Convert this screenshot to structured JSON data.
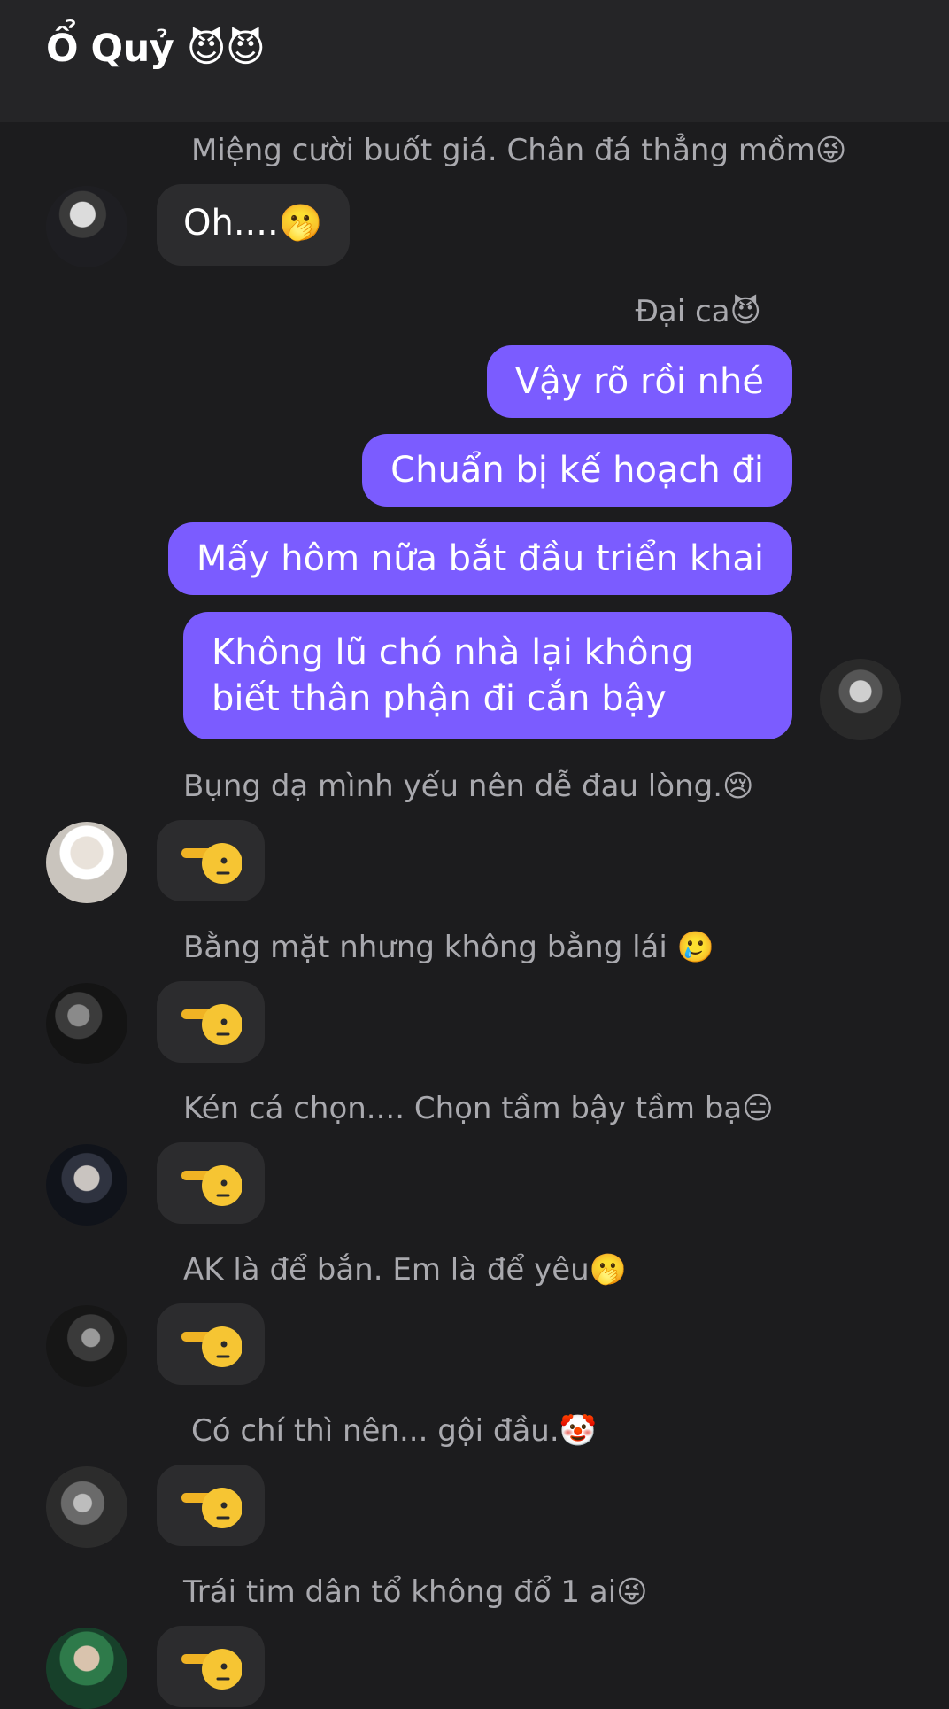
{
  "header": {
    "title": "Ổ Quỷ",
    "title_emoji": "😈😈"
  },
  "messages": [
    {
      "sender": "Miệng cười buốt giá. Chân đá thẳng mồm",
      "sender_emoji": "😜",
      "text": "Oh....",
      "text_emoji": "🫢"
    },
    {
      "sender": "Đại ca",
      "sender_emoji": "😈",
      "outgoing": [
        "Vậy rõ rồi nhé",
        "Chuẩn bị kế hoạch đi",
        "Mấy hôm nữa bắt đầu triển khai",
        "Không lũ chó nhà lại không biết thân phận đi cắn bậy"
      ]
    },
    {
      "sender": "Bụng dạ mình yếu nên dễ đau lòng.",
      "sender_emoji": "😢",
      "sticker": "🫡"
    },
    {
      "sender": "Bằng mặt nhưng không bằng lái ",
      "sender_emoji": "🥲",
      "sticker": "🫡"
    },
    {
      "sender": "Kén cá chọn.... Chọn tầm bậy tầm bạ",
      "sender_emoji": "😑",
      "sticker": "🫡"
    },
    {
      "sender": "AK là để bắn. Em là để yêu",
      "sender_emoji": "🫢",
      "sticker": "🫡"
    },
    {
      "sender": "Có chí thì nên... gội đầu.",
      "sender_emoji": "🤡",
      "sticker": "🫡"
    },
    {
      "sender": "Trái tim dân tổ không đổ 1 ai",
      "sender_emoji": "😜",
      "sticker": "🫡"
    }
  ],
  "colors": {
    "background": "#1c1c1e",
    "header": "#252527",
    "incoming_bubble": "#2c2c2e",
    "outgoing_bubble": "#7b5cff",
    "sender_text": "#a9a9ae"
  },
  "icons": {
    "sticker": "saluting-hand-icon",
    "avatar": "user-avatar"
  }
}
